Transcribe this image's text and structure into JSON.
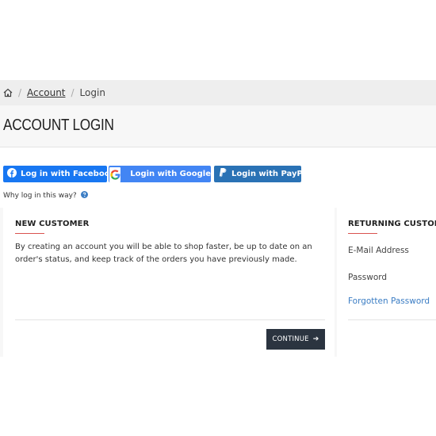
{
  "breadcrumb": {
    "home_icon": "home-icon",
    "separator": "/",
    "account_label": "Account",
    "login_label": "Login"
  },
  "page": {
    "title": "ACCOUNT LOGIN"
  },
  "social": {
    "facebook_label": "Log in with Facebook",
    "google_label": "Login with Google",
    "paypal_label": "Login with PayPal",
    "why_text": "Why log in this way?",
    "colors": {
      "facebook": "#1877f2",
      "google": "#4285f4",
      "paypal": "#2a72b5"
    }
  },
  "new_customer": {
    "heading": "NEW CUSTOMER",
    "description": "By creating an account you will be able to shop faster, be up to date on an order's status, and keep track of the orders you have previously made.",
    "continue_label": "CONTINUE"
  },
  "returning_customer": {
    "heading": "RETURNING CUSTOMER",
    "email_label": "E-Mail Address",
    "password_label": "Password",
    "forgot_label": "Forgotten Password"
  },
  "theme": {
    "accent": "#d9534f",
    "button_dark": "#2b3440",
    "link": "#3b7dc4"
  }
}
